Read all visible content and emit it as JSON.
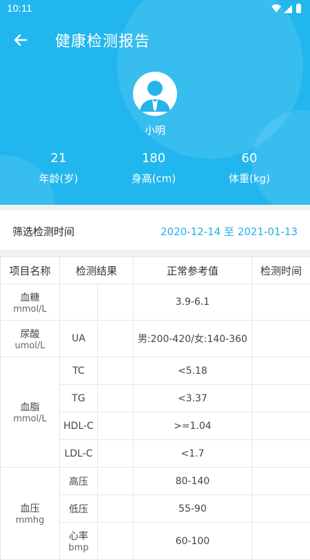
{
  "status_bar": {
    "time": "10:11"
  },
  "header": {
    "title": "健康检测报告"
  },
  "user": {
    "name": "小明"
  },
  "stats": [
    {
      "value": "21",
      "label": "年龄(岁)"
    },
    {
      "value": "180",
      "label": "身高(cm)"
    },
    {
      "value": "60",
      "label": "体重(kg)"
    }
  ],
  "filter": {
    "label": "筛选检测时间",
    "date_range": "2020-12-14 至 2021-01-13"
  },
  "table": {
    "headers": [
      "项目名称",
      "检测结果",
      "正常参考值",
      "检测时间"
    ],
    "groups": {
      "sugar": {
        "name": "血糖",
        "unit": "mmol/L",
        "range": "3.9-6.1"
      },
      "uric": {
        "name": "尿酸",
        "unit": "umol/L",
        "code": "UA",
        "range": "男:200-420/女:140-360"
      },
      "lipid": {
        "name": "血脂",
        "unit": "mmol/L",
        "rows": [
          {
            "code": "TC",
            "range": "<5.18"
          },
          {
            "code": "TG",
            "range": "<3.37"
          },
          {
            "code": "HDL-C",
            "range": ">=1.04"
          },
          {
            "code": "LDL-C",
            "range": "<1.7"
          }
        ]
      },
      "pressure": {
        "name": "血压",
        "unit": "mmhg",
        "rows": [
          {
            "code": "高压",
            "range": "80-140"
          },
          {
            "code": "低压",
            "range": "55-90"
          },
          {
            "code": "心率",
            "code_unit": "bmp",
            "range": "60-100"
          }
        ]
      }
    }
  },
  "colors": {
    "primary": "#22b6ee",
    "accent_text": "#1fb1ea"
  }
}
